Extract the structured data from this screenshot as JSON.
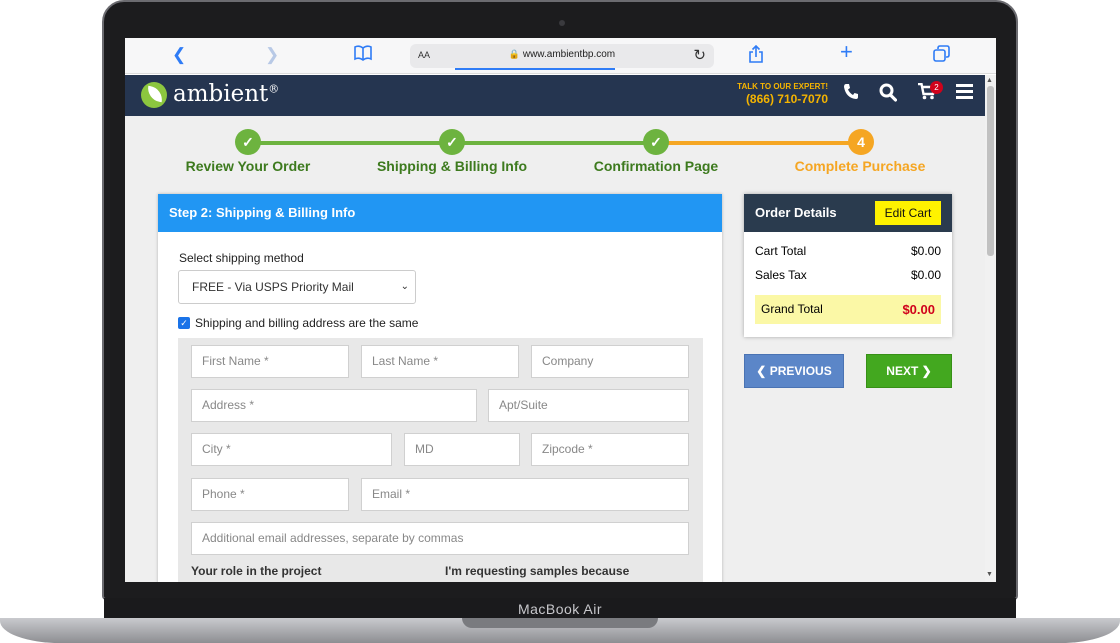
{
  "browser": {
    "url": "www.ambientbp.com",
    "text_size_label": "AA"
  },
  "site": {
    "brand": "ambient",
    "trademark": "®",
    "talk_label": "TALK TO OUR EXPERT!",
    "phone": "(866) 710-7070",
    "cart_count": "2"
  },
  "steps": [
    {
      "label": "Review Your Order",
      "state": "done",
      "marker": "✓"
    },
    {
      "label": "Shipping & Billing Info",
      "state": "done",
      "marker": "✓"
    },
    {
      "label": "Confirmation Page",
      "state": "done",
      "marker": "✓"
    },
    {
      "label": "Complete Purchase",
      "state": "current",
      "marker": "4"
    }
  ],
  "form": {
    "title": "Step 2: Shipping & Billing Info",
    "shipping_method_label": "Select shipping method",
    "shipping_method_value": "FREE - Via USPS Priority Mail",
    "same_address_label": "Shipping and billing address are the same",
    "same_address_checked": true,
    "placeholders": {
      "first_name": "First Name *",
      "last_name": "Last Name *",
      "company": "Company",
      "address": "Address *",
      "apt": "Apt/Suite",
      "city": "City *",
      "state": "MD",
      "zip": "Zipcode *",
      "phone": "Phone *",
      "email": "Email *",
      "additional_emails": "Additional email addresses, separate by commas"
    },
    "role_label": "Your role in the project",
    "reason_label": "I'm requesting samples because"
  },
  "order": {
    "title": "Order Details",
    "edit_cart": "Edit Cart",
    "cart_total_label": "Cart Total",
    "cart_total_value": "$0.00",
    "sales_tax_label": "Sales Tax",
    "sales_tax_value": "$0.00",
    "grand_total_label": "Grand Total",
    "grand_total_value": "$0.00"
  },
  "nav": {
    "previous": "PREVIOUS",
    "next": "NEXT"
  },
  "device": {
    "label": "MacBook Air"
  },
  "colors": {
    "step_done": "#6db33f",
    "step_current": "#f5a623",
    "header_bg": "#253550",
    "card_header": "#2196f3",
    "next_button": "#43a81f",
    "prev_button": "#5b86c8",
    "grand_total": "#d0021b"
  }
}
